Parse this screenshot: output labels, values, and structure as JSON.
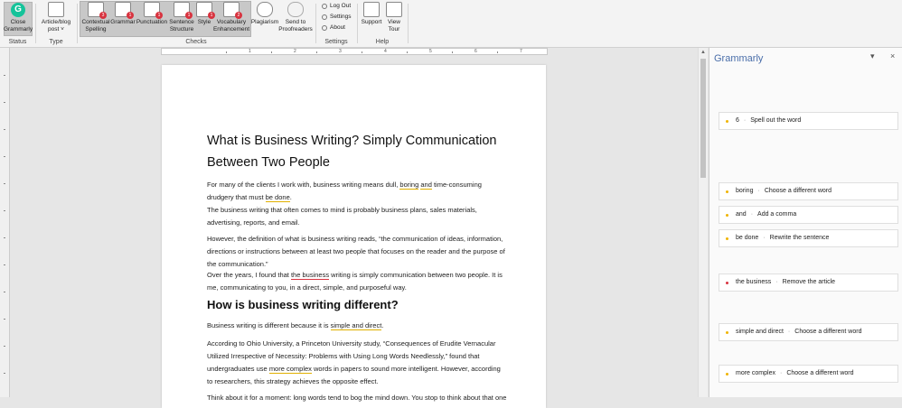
{
  "ribbon": {
    "status": {
      "group_label": "Status",
      "close_label": "Close Grammarly"
    },
    "type": {
      "group_label": "Type",
      "doc_type_label": "Article/blog post ˅"
    },
    "checks": {
      "group_label": "Checks",
      "items": [
        {
          "label": "Contextual Spelling",
          "badge": "3"
        },
        {
          "label": "Grammar",
          "badge": "1"
        },
        {
          "label": "Punctuation",
          "badge": "1"
        },
        {
          "label": "Sentence Structure",
          "badge": "1"
        },
        {
          "label": "Style",
          "badge": "1"
        },
        {
          "label": "Vocabulary Enhancement",
          "badge": "2"
        }
      ],
      "plagiarism_label": "Plagiarism",
      "proofreaders_label": "Send to Proofreaders"
    },
    "settings": {
      "group_label": "Settings",
      "logout_label": "Log Out",
      "settings_label": "Settings",
      "about_label": "About"
    },
    "help": {
      "group_label": "Help",
      "support_label": "Support",
      "tour_label": "View Tour"
    }
  },
  "ruler": {
    "numbers": [
      "1",
      "2",
      "3",
      "4",
      "5",
      "6",
      "7"
    ]
  },
  "document": {
    "title": "What is Business Writing? Simply Communication Between Two People",
    "p1_a": "For many of the clients I work with, business writing means dull, ",
    "p1_boring": "boring",
    "p1_space": " ",
    "p1_and": "and",
    "p1_b": " time-consuming drudgery that must ",
    "p1_bedone": "be done",
    "p1_c": ".",
    "p2": "The business writing that often comes to mind is probably business plans, sales materials, advertising, reports, and email.",
    "p3": "However, the definition of what is business writing reads, “the communication of ideas, information, directions or instructions between at least two people that focuses on the reader and the purpose of the communication.”",
    "p4_a": "Over the years, I found that ",
    "p4_the_business": "the business",
    "p4_b": " writing is simply communication between two people. It is me, communicating to you, in a direct, simple, and purposeful way.",
    "h2": "How is business writing different?",
    "p5_a": "Business writing is different because it is ",
    "p5_simple": "simple and direct",
    "p5_b": ".",
    "p6_a": "According to Ohio University, a Princeton University study, “Consequences of Erudite Vernacular Utilized Irrespective of Necessity:  Problems with Using Long Words Needlessly,” found that undergraduates use ",
    "p6_more": "more complex",
    "p6_b": " words in papers to sound more intelligent.  However, according to researchers, this strategy achieves the opposite effect.",
    "p7": "Think about it for a moment: long words tend to bog the mind down. You stop to think about that one"
  },
  "grammarly_pane": {
    "title": "Grammarly",
    "collapse_icon": "▾",
    "close_icon": "×",
    "cards": [
      {
        "word": "6",
        "suggestion": "Spell out the word",
        "color": "#f0b400"
      },
      {
        "word": "boring",
        "suggestion": "Choose a different word",
        "color": "#f0b400"
      },
      {
        "word": "and",
        "suggestion": "Add a comma",
        "color": "#f0b400"
      },
      {
        "word": "be done",
        "suggestion": "Rewrite the sentence",
        "color": "#f0b400"
      },
      {
        "word": "the business",
        "suggestion": "Remove the article",
        "color": "#d8333f"
      },
      {
        "word": "simple and direct",
        "suggestion": "Choose a different word",
        "color": "#f0b400"
      },
      {
        "word": "more complex",
        "suggestion": "Choose a different word",
        "color": "#f0b400"
      }
    ]
  },
  "colors": {
    "accent": "#15c39a",
    "badge": "#d8333f",
    "title_blue": "#4a6ea9",
    "warn_yellow": "#f0b400"
  }
}
